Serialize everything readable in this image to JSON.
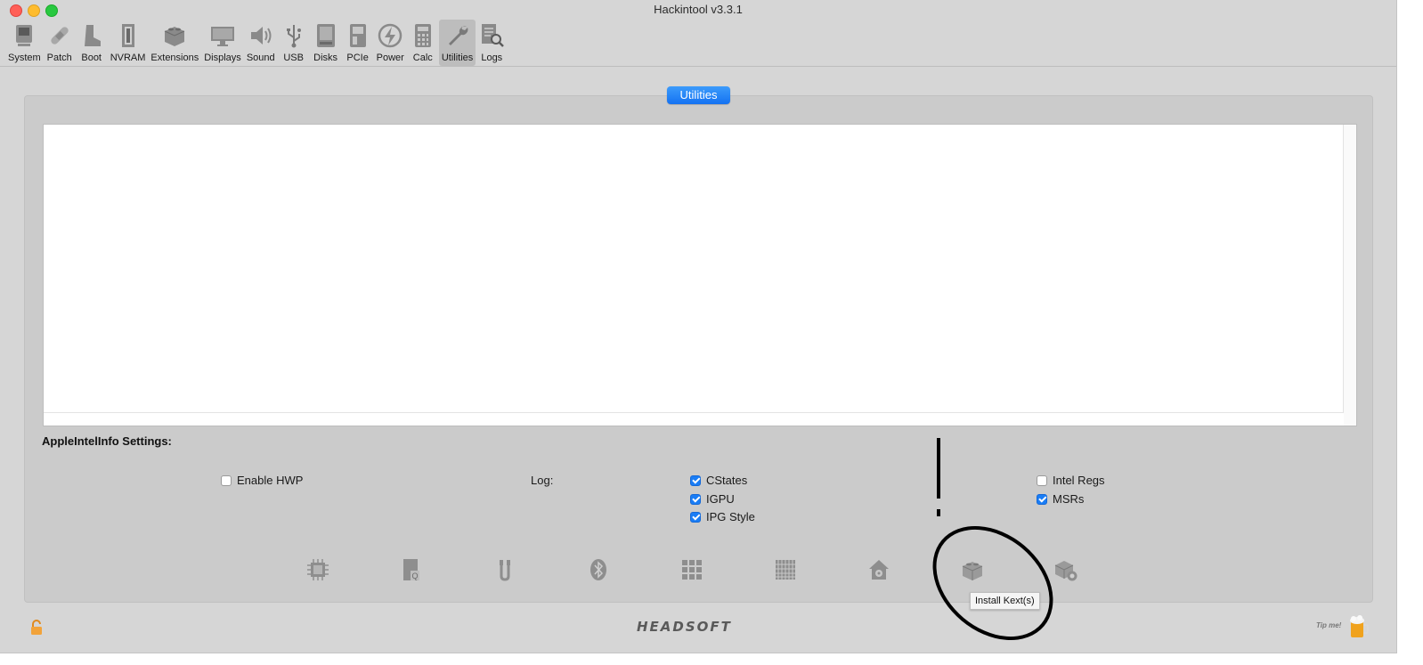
{
  "window": {
    "title": "Hackintool v3.3.1"
  },
  "toolbar": {
    "items": [
      {
        "label": "System",
        "icon": "computer-icon"
      },
      {
        "label": "Patch",
        "icon": "bandage-icon"
      },
      {
        "label": "Boot",
        "icon": "boot-icon"
      },
      {
        "label": "NVRAM",
        "icon": "memory-icon"
      },
      {
        "label": "Extensions",
        "icon": "lego-brick-icon"
      },
      {
        "label": "Displays",
        "icon": "display-icon"
      },
      {
        "label": "Sound",
        "icon": "speaker-icon"
      },
      {
        "label": "USB",
        "icon": "usb-icon"
      },
      {
        "label": "Disks",
        "icon": "disk-icon"
      },
      {
        "label": "PCIe",
        "icon": "pcie-card-icon"
      },
      {
        "label": "Power",
        "icon": "power-bolt-icon"
      },
      {
        "label": "Calc",
        "icon": "calculator-icon"
      },
      {
        "label": "Utilities",
        "icon": "wrench-icon",
        "active": true
      },
      {
        "label": "Logs",
        "icon": "log-magnifier-icon"
      }
    ]
  },
  "panel": {
    "tab_label": "Utilities"
  },
  "settings": {
    "title": "AppleIntelInfo Settings:",
    "enable_hwp": {
      "label": "Enable HWP",
      "checked": false
    },
    "log_label": "Log:",
    "cstates": {
      "label": "CStates",
      "checked": true
    },
    "igpu": {
      "label": "IGPU",
      "checked": true
    },
    "ipg_style": {
      "label": "IPG Style",
      "checked": true
    },
    "intel_regs": {
      "label": "Intel Regs",
      "checked": false
    },
    "msrs": {
      "label": "MSRs",
      "checked": true
    }
  },
  "bottom_icons": [
    "cpu-chip-icon",
    "disk-q-icon",
    "usb-cables-icon",
    "bluetooth-icon",
    "grid-apps-icon",
    "keyboard-grid-icon",
    "home-disk-icon",
    "install-kext-icon",
    "kext-settings-icon"
  ],
  "tooltip": "Install Kext(s)",
  "footer": {
    "brand": "HEADSOFT",
    "tip": "Tip me!"
  },
  "colors": {
    "accent": "#1a7df5",
    "window_bg": "#d6d6d6",
    "panel_bg": "#cbcbcb"
  }
}
